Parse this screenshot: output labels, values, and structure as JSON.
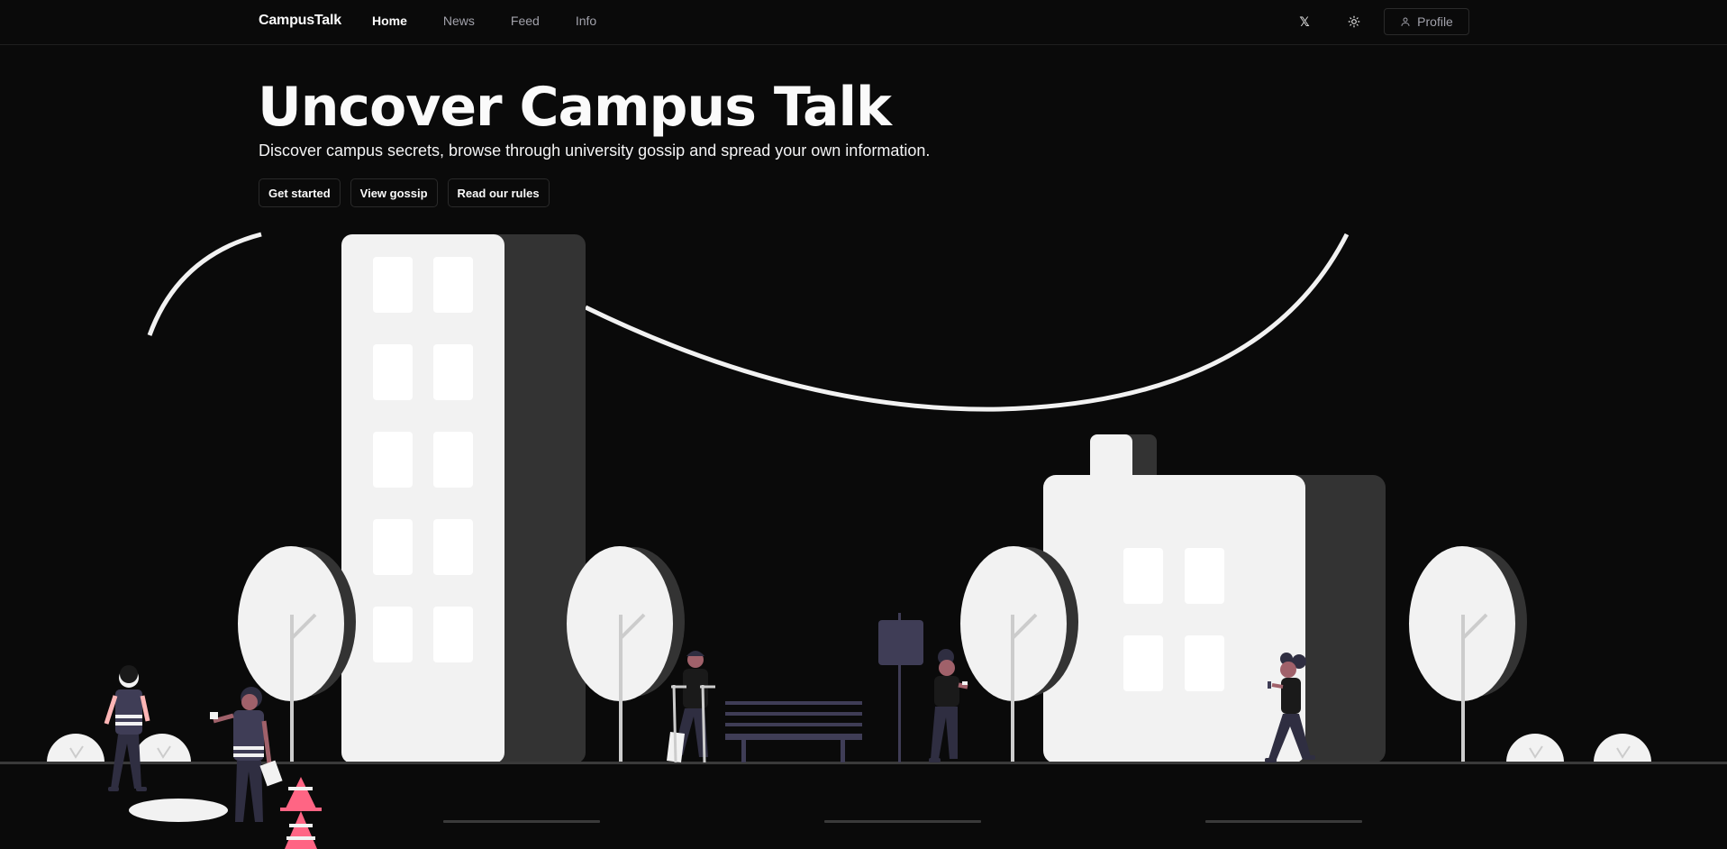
{
  "nav": {
    "brand": "CampusTalk",
    "links": [
      {
        "label": "Home",
        "active": true
      },
      {
        "label": "News",
        "active": false
      },
      {
        "label": "Feed",
        "active": false
      },
      {
        "label": "Info",
        "active": false
      }
    ],
    "x_label": "𝕏",
    "profile_label": "Profile"
  },
  "hero": {
    "title": "Uncover Campus Talk",
    "subtitle": "Discover campus secrets, browse through university gossip and spread your own information.",
    "buttons": {
      "get_started": "Get started",
      "view_gossip": "View gossip",
      "rules": "Read our rules"
    }
  },
  "colors": {
    "background": "#0a0a0a",
    "building_light": "#f2f2f2",
    "building_shadow": "#333333",
    "bench": "#3f3d56",
    "cone": "#ff6584"
  },
  "icons": {
    "x": "x-logo-icon",
    "theme": "sun-icon",
    "profile": "user-icon"
  }
}
